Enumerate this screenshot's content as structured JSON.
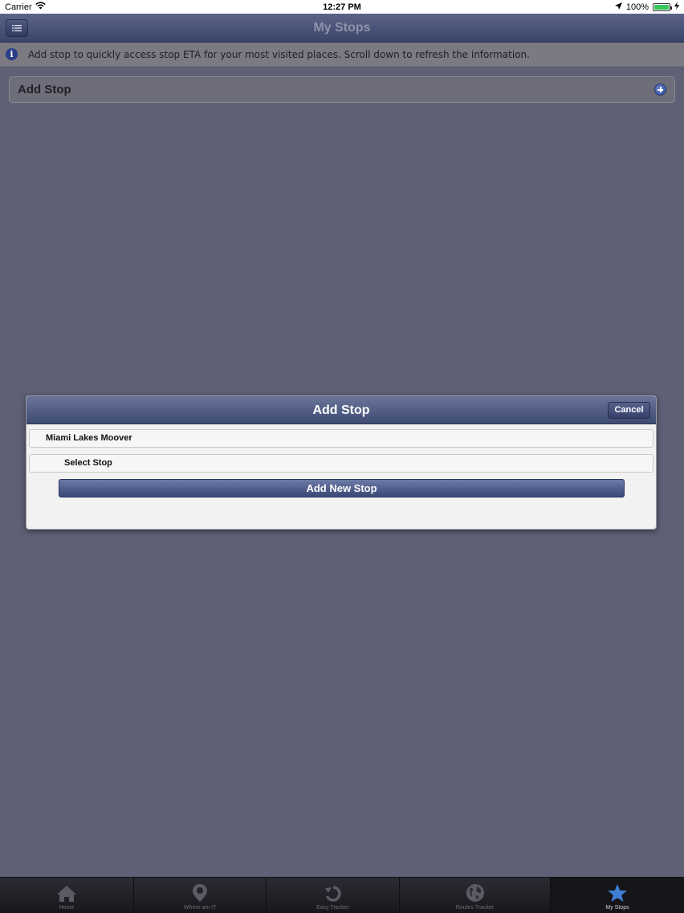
{
  "status_bar": {
    "carrier": "Carrier",
    "time": "12:27 PM",
    "battery": "100%"
  },
  "nav": {
    "title": "My Stops"
  },
  "info_banner": {
    "text": "Add stop to quickly access stop ETA for your most visited places. Scroll down to refresh the information."
  },
  "add_stop_row": {
    "label": "Add Stop"
  },
  "modal": {
    "title": "Add Stop",
    "cancel_label": "Cancel",
    "route_value": "Miami Lakes Moover",
    "stop_value": "Select Stop",
    "add_button_label": "Add New Stop"
  },
  "tabs": [
    {
      "label": "Home",
      "icon": "home-icon"
    },
    {
      "label": "Where am I?",
      "icon": "location-pin-icon"
    },
    {
      "label": "Easy Tracker",
      "icon": "refresh-arrow-icon"
    },
    {
      "label": "Routes Tracker",
      "icon": "globe-icon"
    },
    {
      "label": "My Stops",
      "icon": "star-icon",
      "active": true
    }
  ],
  "colors": {
    "background": "#5f6076",
    "nav_dark": "#3a4569",
    "accent_blue": "#2c4a97",
    "active_star": "#3f7fd6"
  }
}
